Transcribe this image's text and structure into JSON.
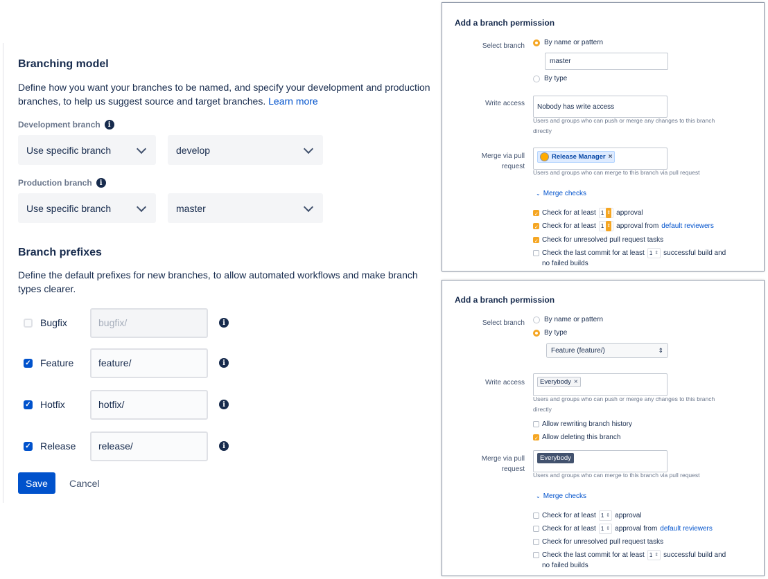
{
  "branching_model": {
    "title": "Branching model",
    "description_pre": "Define how you want your branches to be named, and specify your development and production branches, to help us suggest source and target branches.",
    "learn_more": "Learn more",
    "development": {
      "label": "Development branch",
      "mode": "Use specific branch",
      "branch": "develop"
    },
    "production": {
      "label": "Production branch",
      "mode": "Use specific branch",
      "branch": "master"
    }
  },
  "branch_prefixes": {
    "title": "Branch prefixes",
    "description": "Define the default prefixes for new branches, to allow automated workflows and make branch types clearer.",
    "items": [
      {
        "label": "Bugfix",
        "value": "bugfix/",
        "checked": false
      },
      {
        "label": "Feature",
        "value": "feature/",
        "checked": true
      },
      {
        "label": "Hotfix",
        "value": "hotfix/",
        "checked": true
      },
      {
        "label": "Release",
        "value": "release/",
        "checked": true
      }
    ]
  },
  "actions": {
    "save": "Save",
    "cancel": "Cancel"
  },
  "panel1": {
    "title": "Add a branch permission",
    "select_branch_label": "Select branch",
    "by_name": "By name or pattern",
    "name_value": "master",
    "by_type": "By type",
    "write_access_label": "Write access",
    "write_access_value": "Nobody has write access",
    "write_help_1": "Users and groups who can push or merge any changes to this branch",
    "write_help_2": "directly",
    "merge_label_1": "Merge via pull",
    "merge_label_2": "request",
    "merge_tag": "Release Manager",
    "merge_help": "Users and groups who can merge to this branch via pull request",
    "merge_checks": "Merge checks",
    "check1_pre": "Check for at least",
    "check1_num": "1",
    "check1_post": "approval",
    "check2_pre": "Check for at least",
    "check2_num": "1",
    "check2_post": "approval from",
    "check2_link": "default reviewers",
    "check3": "Check for unresolved pull request tasks",
    "check4_pre": "Check the last commit for at least",
    "check4_num": "1",
    "check4_post": "successful build and",
    "check4_post2": "no failed builds"
  },
  "panel2": {
    "title": "Add a branch permission",
    "select_branch_label": "Select branch",
    "by_name": "By name or pattern",
    "by_type": "By type",
    "type_value": "Feature (feature/)",
    "write_access_label": "Write access",
    "write_tag": "Everybody",
    "write_help_1": "Users and groups who can push or merge any changes to this branch",
    "write_help_2": "directly",
    "allow_rewrite": "Allow rewriting branch history",
    "allow_delete": "Allow deleting this branch",
    "merge_label_1": "Merge via pull",
    "merge_label_2": "request",
    "merge_tag": "Everybody",
    "merge_help": "Users and groups who can merge to this branch via pull request",
    "merge_checks": "Merge checks",
    "check1_pre": "Check for at least",
    "check1_num": "1",
    "check1_post": "approval",
    "check2_pre": "Check for at least",
    "check2_num": "1",
    "check2_post": "approval from",
    "check2_link": "default reviewers",
    "check3": "Check for unresolved pull request tasks",
    "check4_pre": "Check the last commit for at least",
    "check4_num": "1",
    "check4_post": "successful build and",
    "check4_post2": "no failed builds"
  }
}
